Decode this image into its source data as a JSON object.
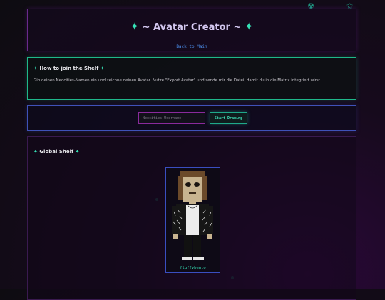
{
  "header": {
    "title_text": "~ Avatar Creator ~",
    "back_link": "Back to Main"
  },
  "info": {
    "heading": "How to join the Shelf",
    "body": "Gib deinen Neocities-Namen ein und zeichne deinen Avatar. Nutze \"Export Avatar\" und sende mir die Datei, damit du in die Matrix integriert wirst."
  },
  "form": {
    "username_placeholder": "Neocities Username",
    "start_button": "Start Drawing"
  },
  "shelf": {
    "heading": "Global Shelf",
    "avatars": [
      {
        "username": "fluffybento"
      }
    ]
  },
  "colors": {
    "accent_green": "#35e0b5",
    "accent_purple": "#8a2a9c",
    "accent_blue": "#3f52b8",
    "link_blue": "#4a8ce8"
  },
  "icons": {
    "diamond": "✦",
    "corner_1": "radiation-icon",
    "corner_2": "star-icon"
  }
}
